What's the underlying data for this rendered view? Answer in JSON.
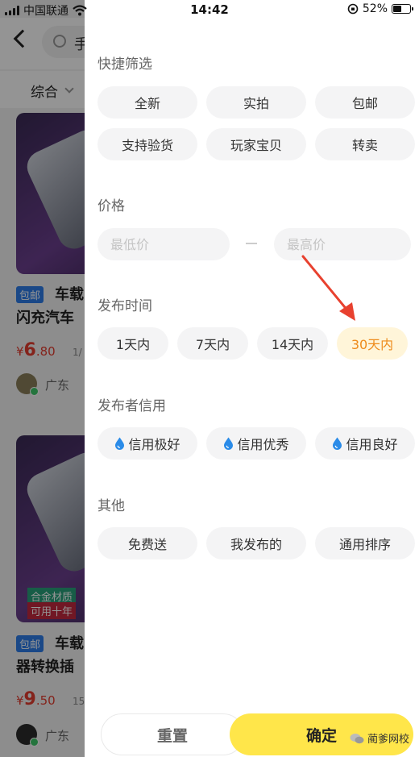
{
  "status_bar": {
    "carrier": "中国联通",
    "time": "14:42",
    "battery": "52%",
    "battery_level": 0.52
  },
  "background": {
    "search_text": "手",
    "sort_label": "综合",
    "cards": [
      {
        "tag": "包邮",
        "title_line1": "车载",
        "title_line2": "闪充汽车",
        "price_symbol": "¥",
        "price_int": "6",
        "price_dec": ".80",
        "sold": "1/",
        "location": "广东"
      },
      {
        "tag": "包邮",
        "title_line1": "车载",
        "title_line2": "器转换插",
        "price_symbol": "¥",
        "price_int": "9",
        "price_dec": ".50",
        "sold": "15",
        "location": "广东",
        "badge_material": "合金材质",
        "badge_years": "可用十年"
      }
    ]
  },
  "filter": {
    "quick": {
      "title": "快捷筛选",
      "chips": [
        "全新",
        "实拍",
        "包邮",
        "支持验货",
        "玩家宝贝",
        "转卖"
      ]
    },
    "price": {
      "title": "价格",
      "min_placeholder": "最低价",
      "max_placeholder": "最高价"
    },
    "time": {
      "title": "发布时间",
      "chips": [
        "1天内",
        "7天内",
        "14天内",
        "30天内"
      ],
      "selected": "30天内"
    },
    "credit": {
      "title": "发布者信用",
      "chips": [
        "信用极好",
        "信用优秀",
        "信用良好"
      ]
    },
    "other": {
      "title": "其他",
      "chips": [
        "免费送",
        "我发布的",
        "通用排序"
      ]
    },
    "buttons": {
      "reset": "重置",
      "confirm": "确定"
    }
  },
  "watermark": "蔺爹网校",
  "colors": {
    "accent_yellow": "#ffe64a",
    "selected_text": "#ee8b1b",
    "selected_bg": "#fff5d9",
    "credit_drop": "#2a8be8",
    "annotation_arrow": "#e8412f"
  }
}
